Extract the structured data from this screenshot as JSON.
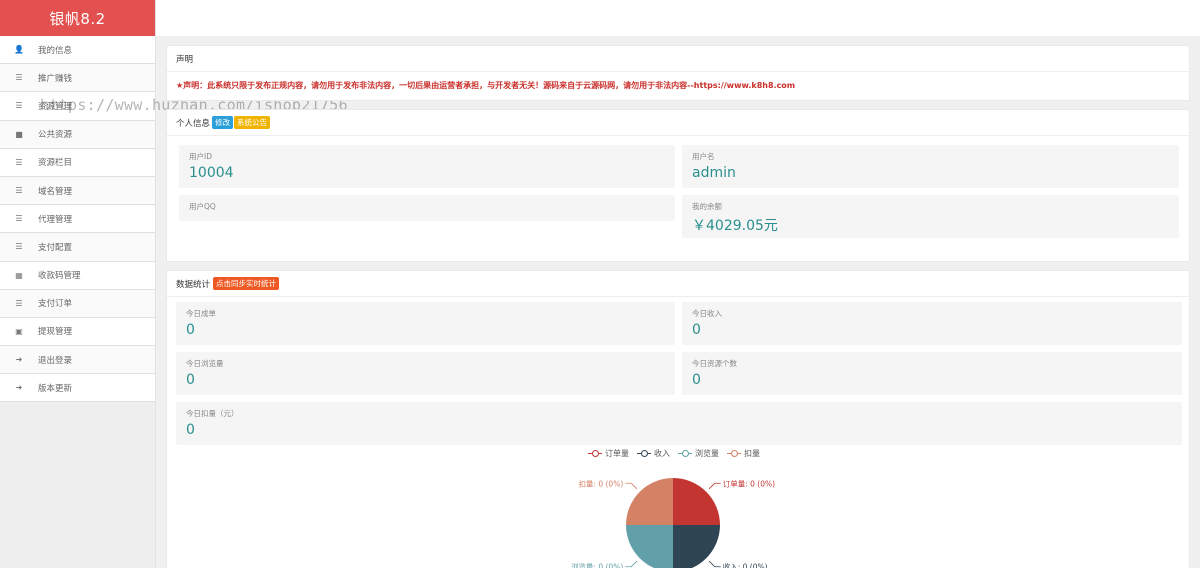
{
  "brand": "银帆8.2",
  "sidebar": {
    "items": [
      {
        "label": "我的信息",
        "icon": "user-icon",
        "glyph": "👤"
      },
      {
        "label": "推广赚钱",
        "icon": "list-icon",
        "glyph": "☰"
      },
      {
        "label": "资源管理",
        "icon": "list-icon",
        "glyph": "☰"
      },
      {
        "label": "公共资源",
        "icon": "video-icon",
        "glyph": "■"
      },
      {
        "label": "资源栏目",
        "icon": "list-icon",
        "glyph": "☰"
      },
      {
        "label": "域名管理",
        "icon": "list-icon",
        "glyph": "☰"
      },
      {
        "label": "代理管理",
        "icon": "list-icon",
        "glyph": "☰"
      },
      {
        "label": "支付配置",
        "icon": "list-icon",
        "glyph": "☰"
      },
      {
        "label": "收款码管理",
        "icon": "qrcode-icon",
        "glyph": "▦"
      },
      {
        "label": "支付订单",
        "icon": "list-icon",
        "glyph": "☰"
      },
      {
        "label": "提现管理",
        "icon": "money-icon",
        "glyph": "▣"
      },
      {
        "label": "退出登录",
        "icon": "sign-out-icon",
        "glyph": "➜"
      },
      {
        "label": "版本更新",
        "icon": "sign-in-icon",
        "glyph": "➜"
      }
    ]
  },
  "watermark": "https://www.huzhan.com/ishop21756",
  "notice": {
    "title": "声明",
    "star": "★",
    "text": "声明：此系统只限于发布正规内容，请勿用于发布非法内容，一切后果由运营者承担，与开发者无关！源码来自于云源码网，请勿用于非法内容--https://www.k8h8.com"
  },
  "personal": {
    "title": "个人信息",
    "edit_badge": "修改",
    "announce_badge": "系统公告",
    "user_id_label": "用户ID",
    "user_id": "10004",
    "username_label": "用户名",
    "username": "admin",
    "qq_label": "用户QQ",
    "qq": "",
    "balance_label": "我的余额",
    "balance": "￥4029.05元"
  },
  "stats": {
    "title": "数据统计",
    "sync_badge": "点击同步实时统计",
    "today_orders_label": "今日成单",
    "today_orders": "0",
    "today_income_label": "今日收入",
    "today_income": "0",
    "today_views_label": "今日浏览量",
    "today_views": "0",
    "today_resources_label": "今日资源个数",
    "today_resources": "0",
    "today_deduct_label": "今日扣量（元）",
    "today_deduct": "0"
  },
  "colors": {
    "brand": "#e35050",
    "accent_value": "#2a8f8f",
    "notice_red": "#c9302c",
    "badge_blue": "#2b9fd9",
    "badge_yellow": "#f0b400",
    "badge_orange": "#ef5a24"
  },
  "chart_data": {
    "type": "pie",
    "legend_position": "top-center",
    "series": [
      {
        "name": "订单量",
        "value": 0,
        "label": "订单量: 0 (0%)",
        "color": "#c23531"
      },
      {
        "name": "收入",
        "value": 0,
        "label": "收入: 0 (0%)",
        "color": "#2f4554"
      },
      {
        "name": "浏览量",
        "value": 0,
        "label": "浏览量: 0 (0%)",
        "color": "#61a0a8"
      },
      {
        "name": "扣量",
        "value": 0,
        "label": "扣量: 0 (0%)",
        "color": "#d48265"
      }
    ]
  }
}
